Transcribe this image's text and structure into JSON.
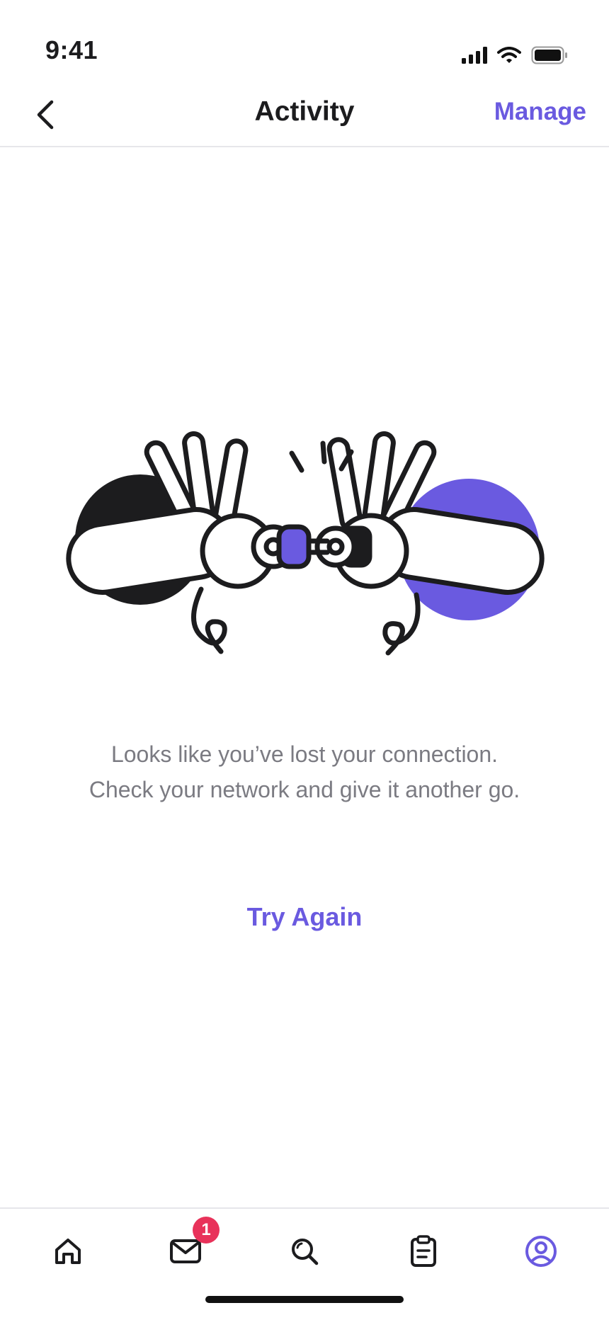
{
  "status_bar": {
    "time": "9:41",
    "icons": [
      "signal-icon",
      "wifi-icon",
      "battery-icon"
    ]
  },
  "nav": {
    "back_icon": "chevron-left-icon",
    "title": "Activity",
    "action_label": "Manage"
  },
  "illustration": {
    "description_icon": "high-five-disconnected-illustration"
  },
  "error": {
    "message": "Looks like you’ve lost your connection. Check your network and give it another go.",
    "retry_label": "Try Again"
  },
  "tab_bar": {
    "items": [
      {
        "icon": "home-icon",
        "active": false
      },
      {
        "icon": "mail-icon",
        "active": false,
        "badge": "1"
      },
      {
        "icon": "search-icon",
        "active": false
      },
      {
        "icon": "clipboard-icon",
        "active": false
      },
      {
        "icon": "profile-icon",
        "active": true
      }
    ]
  },
  "colors": {
    "accent": "#6a5ae0",
    "text_primary": "#1c1c1e",
    "text_secondary": "#7b7b82",
    "badge": "#e8325a",
    "divider": "#e6e6ea"
  }
}
